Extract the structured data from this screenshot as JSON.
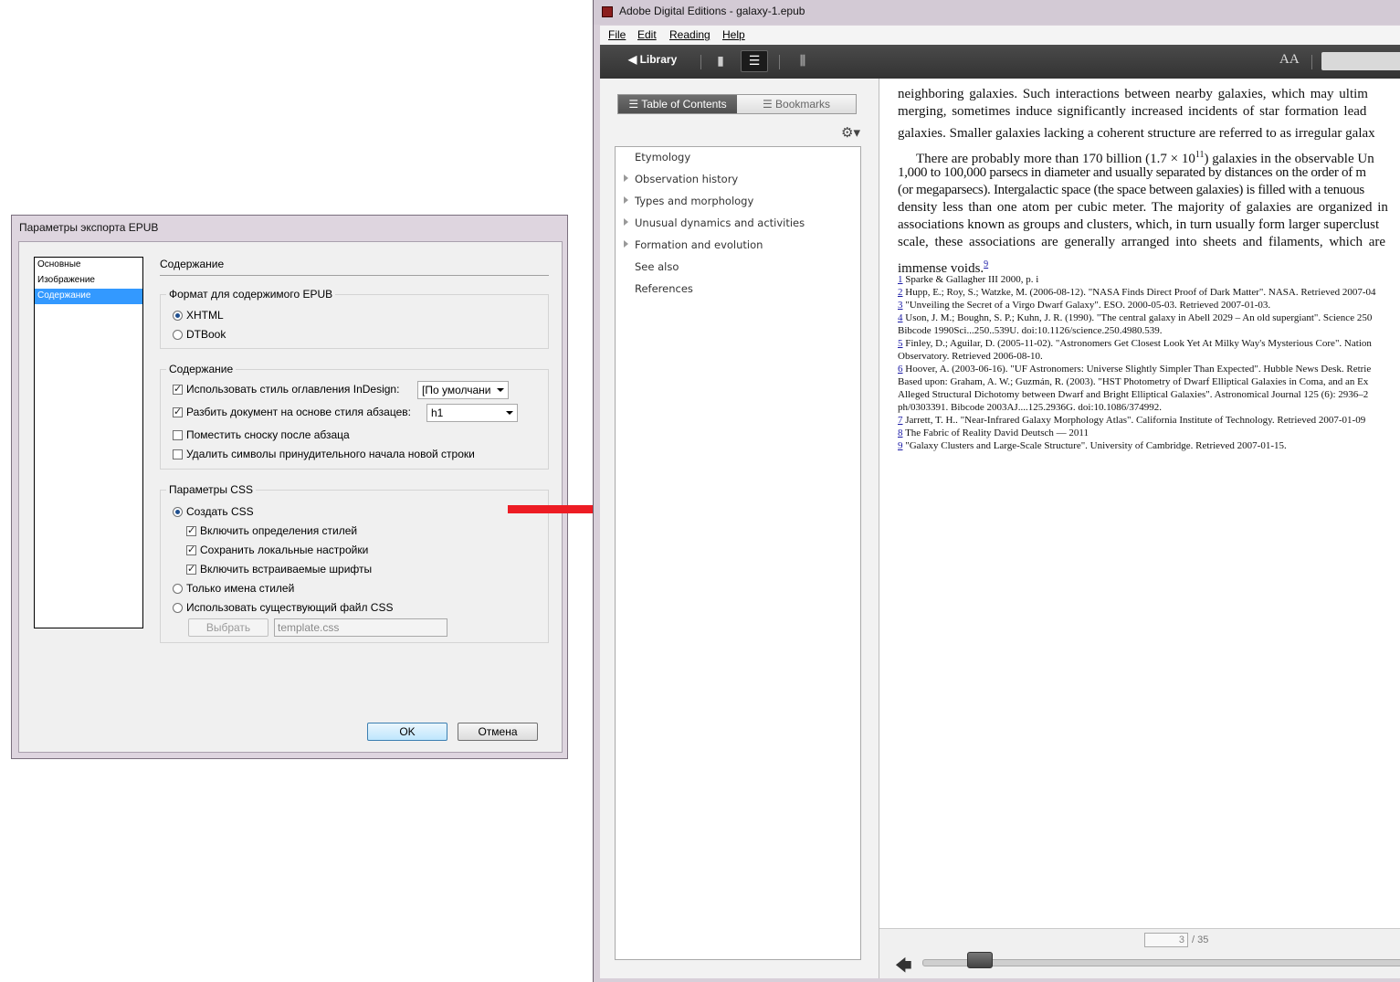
{
  "dialog": {
    "title": "Параметры экспорта EPUB",
    "nav": [
      "Основные",
      "Изображение",
      "Содержание"
    ],
    "selected_nav": "Содержание",
    "section_title": "Содержание",
    "format_group": "Формат для содержимого EPUB",
    "format_xhtml": "XHTML",
    "format_dtbook": "DTBook",
    "content_group": "Содержание",
    "toc_style_label": "Использовать стиль оглавления InDesign:",
    "toc_style_value": "[По умолчани",
    "split_label": "Разбить документ на основе стиля абзацев:",
    "split_value": "h1",
    "footnote_label": "Поместить сноску после абзаца",
    "remove_breaks_label": "Удалить символы принудительного начала новой строки",
    "css_group": "Параметры CSS",
    "create_css": "Создать CSS",
    "include_styles": "Включить определения стилей",
    "keep_local": "Сохранить локальные настройки",
    "embed_fonts": "Включить встраиваемые шрифты",
    "style_names_only": "Только имена стилей",
    "use_existing_css": "Использовать существующий файл CSS",
    "choose_button": "Выбрать",
    "css_file": "template.css",
    "ok_button": "OK",
    "cancel_button": "Отмена"
  },
  "ade": {
    "title": "Adobe Digital Editions - galaxy-1.epub",
    "menu": [
      "File",
      "Edit",
      "Reading",
      "Help"
    ],
    "library_button": "◀ Library",
    "font_size_button": "AA",
    "tabs": {
      "toc": "Table of Contents",
      "bookmarks": "Bookmarks"
    },
    "toc_items": [
      {
        "label": "Etymology",
        "expandable": false
      },
      {
        "label": "Observation history",
        "expandable": true
      },
      {
        "label": "Types and morphology",
        "expandable": true
      },
      {
        "label": "Unusual dynamics and activities",
        "expandable": true
      },
      {
        "label": "Formation and evolution",
        "expandable": true
      },
      {
        "label": "See also",
        "expandable": false
      },
      {
        "label": "References",
        "expandable": false
      }
    ],
    "body_lines": [
      "neighboring galaxies. Such interactions between nearby galaxies, which may ultim",
      "merging, sometimes induce significantly increased incidents of star formation lead",
      "galaxies. Smaller galaxies lacking a coherent structure are referred to as irregular galax"
    ],
    "para2_lines": [
      "There are probably more than 170 billion (1.7 × 10",
      "1,000 to 100,000 parsecs in diameter and usually separated by distances on the order of m",
      "(or megaparsecs). Intergalactic space (the space between galaxies) is filled with a tenuous",
      "density less than one atom per cubic meter. The majority of galaxies are organized in",
      "associations known as groups and clusters, which, in turn usually form larger superclust",
      "scale, these associations are generally arranged into sheets and filaments, which are",
      "immense voids."
    ],
    "para2_sup": "11",
    "para2_after_sup": ") galaxies in the observable Un",
    "final_ref": "9",
    "footnotes": [
      {
        "n": "1",
        "text": "Sparke & Gallagher III 2000, p. i"
      },
      {
        "n": "2",
        "text": "Hupp, E.; Roy, S.; Watzke, M. (2006-08-12). \"NASA Finds Direct Proof of Dark Matter\". NASA. Retrieved 2007-04"
      },
      {
        "n": "3",
        "text": "\"Unveiling the Secret of a Virgo Dwarf Galaxy\". ESO. 2000-05-03. Retrieved 2007-01-03."
      },
      {
        "n": "4",
        "text": "Uson, J. M.; Boughn, S. P.; Kuhn, J. R. (1990). \"The central galaxy in Abell 2029 – An old supergiant\". Science 250"
      },
      {
        "n": "",
        "text": "Bibcode 1990Sci...250..539U. doi:10.1126/science.250.4980.539."
      },
      {
        "n": "5",
        "text": "Finley, D.; Aguilar, D. (2005-11-02). \"Astronomers Get Closest Look Yet At Milky Way's Mysterious Core\". Nation"
      },
      {
        "n": "",
        "text": "Observatory. Retrieved 2006-08-10."
      },
      {
        "n": "6",
        "text": "Hoover, A. (2003-06-16). \"UF Astronomers: Universe Slightly Simpler Than Expected\". Hubble News Desk. Retrie"
      },
      {
        "n": "",
        "text": "Based upon: Graham, A. W.; Guzmán, R. (2003). \"HST Photometry of Dwarf Elliptical Galaxies in Coma, and an Ex"
      },
      {
        "n": "",
        "text": "Alleged Structural Dichotomy between Dwarf and Bright Elliptical Galaxies\". Astronomical Journal 125 (6): 2936–2"
      },
      {
        "n": "",
        "text": "ph/0303391. Bibcode 2003AJ....125.2936G. doi:10.1086/374992."
      },
      {
        "n": "7",
        "text": "Jarrett, T. H.. \"Near-Infrared Galaxy Morphology Atlas\". California Institute of Technology. Retrieved 2007-01-09"
      },
      {
        "n": "8",
        "text": "The Fabric of Reality David Deutsch — 2011"
      },
      {
        "n": "9",
        "text": "\"Galaxy Clusters and Large-Scale Structure\". University of Cambridge. Retrieved 2007-01-15."
      }
    ],
    "current_page": "3",
    "total_pages": "/ 35",
    "progress_fraction": 0.09
  },
  "colors": {
    "selection": "#3399ff",
    "arrow": "#ed1c24",
    "link": "#1a1aa6"
  }
}
